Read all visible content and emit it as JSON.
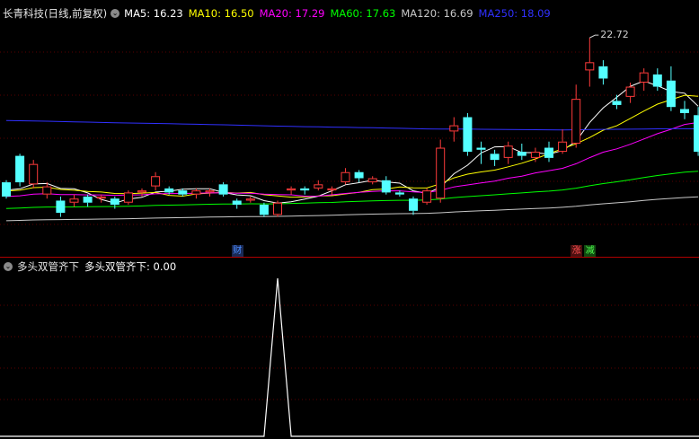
{
  "header": {
    "title": "长青科技(日线,前复权)",
    "ma": [
      {
        "label": "MA5:",
        "value": "16.23",
        "color": "#ffffff"
      },
      {
        "label": "MA10:",
        "value": "16.50",
        "color": "#ffff00"
      },
      {
        "label": "MA20:",
        "value": "17.29",
        "color": "#ff00ff"
      },
      {
        "label": "MA60:",
        "value": "17.63",
        "color": "#00ff00"
      },
      {
        "label": "MA120:",
        "value": "16.69",
        "color": "#c8c8c8"
      },
      {
        "label": "MA250:",
        "value": "18.09",
        "color": "#3030ff"
      }
    ]
  },
  "indicator": {
    "name": "多头双管齐下",
    "value_label": "多头双管齐下: 0.00",
    "signal": [
      0,
      0,
      0,
      0,
      0,
      0,
      0,
      0,
      0,
      0,
      0,
      0,
      0,
      0,
      0,
      0,
      0,
      0,
      0,
      0,
      1,
      0,
      0,
      0,
      0,
      0,
      0,
      0,
      0,
      0,
      0,
      0,
      0,
      0,
      0,
      0,
      0,
      0,
      0,
      0,
      0,
      0,
      0,
      0,
      0,
      0,
      0,
      0,
      0,
      0,
      0,
      0
    ]
  },
  "events": [
    {
      "label": "财",
      "bar": 17,
      "color": "#4a8cff",
      "bg": "#1a2a55"
    },
    {
      "label": "涨",
      "bar": 42,
      "color": "#ff5050",
      "bg": "#4a1010"
    },
    {
      "label": "减",
      "bar": 43,
      "color": "#50ff50",
      "bg": "#104a10"
    }
  ],
  "chart_data": {
    "type": "candlestick",
    "high_label": "22.72",
    "high_bar": 43,
    "ylim": [
      13.0,
      23.5
    ],
    "up_color": "#ff3b3b",
    "down_color": "#54ffff",
    "candles": [
      [
        15.6,
        14.9,
        15.7,
        14.8
      ],
      [
        16.9,
        15.6,
        17.0,
        15.4
      ],
      [
        15.5,
        16.5,
        16.7,
        15.3
      ],
      [
        15.0,
        15.4,
        15.6,
        14.8
      ],
      [
        14.7,
        14.1,
        14.9,
        13.9
      ],
      [
        14.6,
        14.8,
        15.0,
        14.4
      ],
      [
        14.9,
        14.6,
        15.0,
        14.4
      ],
      [
        14.8,
        14.9,
        15.0,
        14.6
      ],
      [
        14.8,
        14.5,
        14.9,
        14.3
      ],
      [
        14.6,
        15.1,
        15.2,
        14.5
      ],
      [
        15.1,
        15.2,
        15.3,
        14.9
      ],
      [
        15.4,
        15.9,
        16.1,
        15.2
      ],
      [
        15.3,
        15.1,
        15.4,
        15.0
      ],
      [
        15.2,
        15.0,
        15.3,
        14.9
      ],
      [
        15.0,
        15.2,
        15.3,
        14.8
      ],
      [
        15.1,
        15.2,
        15.3,
        14.9
      ],
      [
        15.5,
        15.0,
        15.6,
        14.9
      ],
      [
        14.7,
        14.5,
        14.8,
        14.3
      ],
      [
        14.7,
        14.8,
        14.9,
        14.6
      ],
      [
        14.5,
        14.0,
        14.6,
        13.9
      ],
      [
        14.0,
        14.6,
        14.7,
        13.9
      ],
      [
        15.2,
        15.3,
        15.4,
        15.0
      ],
      [
        15.3,
        15.2,
        15.4,
        15.0
      ],
      [
        15.3,
        15.5,
        15.7,
        15.2
      ],
      [
        15.2,
        15.3,
        15.4,
        15.0
      ],
      [
        15.6,
        16.1,
        16.3,
        15.5
      ],
      [
        16.1,
        15.8,
        16.2,
        15.6
      ],
      [
        15.6,
        15.8,
        15.9,
        15.5
      ],
      [
        15.7,
        15.1,
        15.9,
        15.0
      ],
      [
        15.1,
        15.0,
        15.2,
        14.9
      ],
      [
        14.8,
        14.2,
        14.9,
        14.0
      ],
      [
        14.6,
        15.2,
        15.3,
        14.5
      ],
      [
        14.8,
        17.3,
        17.7,
        14.6
      ],
      [
        18.1,
        18.4,
        18.8,
        17.6
      ],
      [
        18.8,
        17.1,
        19.0,
        16.9
      ],
      [
        17.3,
        17.2,
        17.6,
        16.5
      ],
      [
        17.0,
        16.7,
        17.2,
        16.4
      ],
      [
        16.8,
        17.4,
        17.6,
        16.5
      ],
      [
        17.1,
        16.9,
        17.5,
        16.7
      ],
      [
        16.8,
        17.1,
        17.3,
        16.6
      ],
      [
        17.3,
        16.8,
        17.6,
        16.6
      ],
      [
        17.1,
        17.6,
        18.2,
        17.0
      ],
      [
        17.5,
        19.7,
        20.4,
        17.3
      ],
      [
        21.1,
        21.5,
        22.7,
        20.3
      ],
      [
        21.3,
        20.7,
        21.6,
        20.4
      ],
      [
        19.6,
        19.4,
        19.9,
        19.2
      ],
      [
        19.8,
        20.3,
        20.5,
        19.5
      ],
      [
        20.5,
        21.0,
        21.2,
        20.1
      ],
      [
        20.9,
        20.3,
        21.2,
        20.1
      ],
      [
        20.6,
        19.3,
        21.3,
        19.1
      ],
      [
        19.2,
        19.0,
        19.6,
        18.7
      ],
      [
        18.9,
        17.1,
        19.3,
        16.9
      ]
    ]
  }
}
